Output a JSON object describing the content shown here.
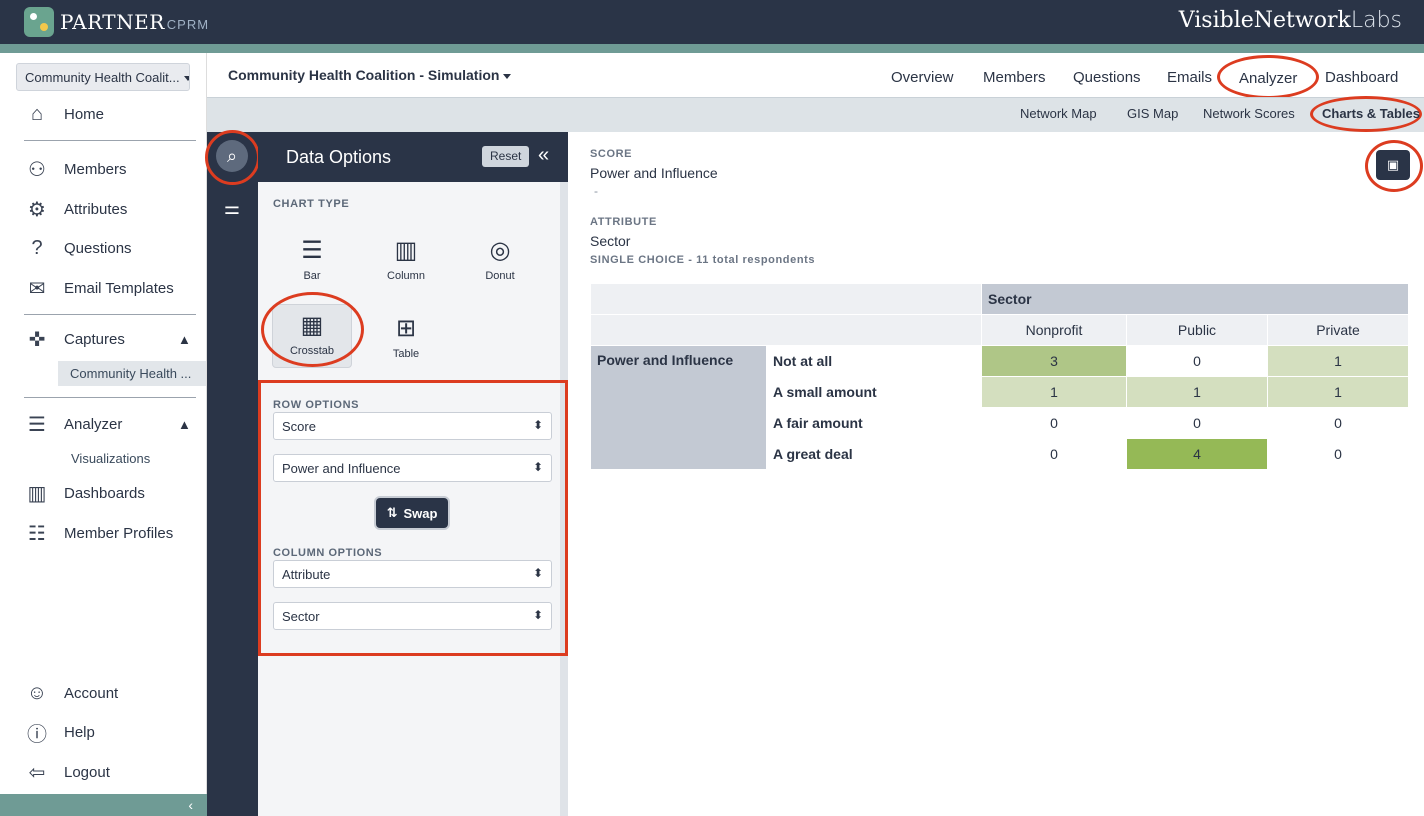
{
  "topbar": {
    "brand": "PARTNER",
    "brand_sub": "CPRM",
    "company_bold": "Visible",
    "company_mid": "Network",
    "company_light": "Labs"
  },
  "sidebar": {
    "coalition_select": "Community Health Coalit...",
    "items": [
      {
        "label": "Home",
        "icon": "home-icon"
      },
      {
        "label": "Members",
        "icon": "members-icon"
      },
      {
        "label": "Attributes",
        "icon": "attributes-icon"
      },
      {
        "label": "Questions",
        "icon": "question-icon"
      },
      {
        "label": "Email Templates",
        "icon": "email-icon"
      },
      {
        "label": "Captures",
        "icon": "captures-icon"
      },
      {
        "label": "Analyzer",
        "icon": "analyzer-icon"
      },
      {
        "label": "Dashboards",
        "icon": "dashboard-icon"
      },
      {
        "label": "Member Profiles",
        "icon": "profile-icon"
      },
      {
        "label": "Account",
        "icon": "account-icon"
      },
      {
        "label": "Help",
        "icon": "help-icon"
      },
      {
        "label": "Logout",
        "icon": "logout-icon"
      }
    ],
    "captures_sub": "Community Health ...",
    "analyzer_sub": "Visualizations"
  },
  "header": {
    "title": "Community Health Coalition - Simulation",
    "tabs": [
      "Overview",
      "Members",
      "Questions",
      "Emails",
      "Analyzer",
      "Dashboard"
    ],
    "active_tab": "Analyzer"
  },
  "subnav": {
    "tabs": [
      "Network Map",
      "GIS Map",
      "Network Scores",
      "Charts & Tables"
    ],
    "active_tab": "Charts & Tables"
  },
  "panel": {
    "title": "Data Options",
    "reset_label": "Reset",
    "chart_type_label": "CHART TYPE",
    "chart_types": [
      "Bar",
      "Column",
      "Donut",
      "Crosstab",
      "Table"
    ],
    "active_chart_type": "Crosstab",
    "row_options_label": "ROW OPTIONS",
    "row_type": "Score",
    "row_value": "Power and Influence",
    "swap_label": "Swap",
    "column_options_label": "COLUMN OPTIONS",
    "column_type": "Attribute",
    "column_value": "Sector"
  },
  "main": {
    "score_label": "SCORE",
    "score_value": "Power and Influence",
    "score_dash": "-",
    "attribute_label": "ATTRIBUTE",
    "attribute_value": "Sector",
    "attribute_meta": "SINGLE CHOICE  -  11 total respondents"
  },
  "chart_data": {
    "type": "table",
    "column_group": "Sector",
    "row_group": "Power and Influence",
    "columns": [
      "Nonprofit",
      "Public",
      "Private"
    ],
    "rows": [
      "Not at all",
      "A small amount",
      "A fair amount",
      "A great deal"
    ],
    "values": [
      [
        3,
        0,
        1
      ],
      [
        1,
        1,
        1
      ],
      [
        0,
        0,
        0
      ],
      [
        0,
        4,
        0
      ]
    ]
  },
  "colors": {
    "navy": "#2a3447",
    "teal": "#6f9b95",
    "highlight_red": "#dc3c20",
    "heat_low": "#d4dfbf",
    "heat_mid": "#afc687",
    "heat_high": "#95b956"
  }
}
